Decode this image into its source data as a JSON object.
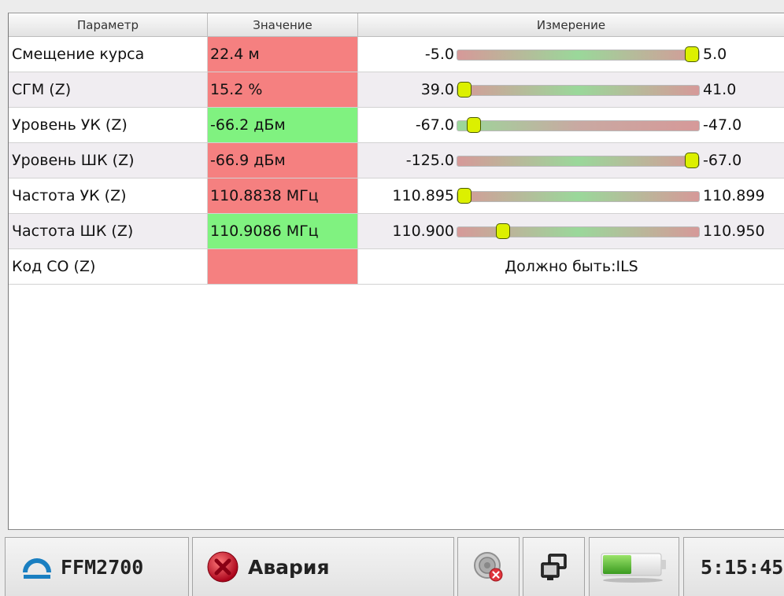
{
  "table": {
    "columns": [
      "Параметр",
      "Значение",
      "Измерение"
    ],
    "rows": [
      {
        "name": "Смещение курса",
        "value": "22.4 м",
        "value_status": "bad",
        "min": "-5.0",
        "max": "5.0",
        "bar_fraction": 1.0,
        "bar_good_zone": "center"
      },
      {
        "name": "СГМ (Z)",
        "value": "15.2 %",
        "value_status": "bad",
        "min": "39.0",
        "max": "41.0",
        "bar_fraction": 0.0,
        "bar_good_zone": "center"
      },
      {
        "name": "Уровень УК (Z)",
        "value": "-66.2 дБм",
        "value_status": "good",
        "min": "-67.0",
        "max": "-47.0",
        "bar_fraction": 0.04,
        "bar_good_zone": "left"
      },
      {
        "name": "Уровень ШК (Z)",
        "value": "-66.9 дБм",
        "value_status": "bad",
        "min": "-125.0",
        "max": "-67.0",
        "bar_fraction": 1.0,
        "bar_good_zone": "center"
      },
      {
        "name": "Частота УК (Z)",
        "value": "110.8838 МГц",
        "value_status": "bad",
        "min": "110.895",
        "max": "110.899",
        "bar_fraction": 0.0,
        "bar_good_zone": "center"
      },
      {
        "name": "Частота ШК (Z)",
        "value": "110.9086 МГц",
        "value_status": "good",
        "min": "110.900",
        "max": "110.950",
        "bar_fraction": 0.17,
        "bar_good_zone": "center"
      },
      {
        "name": "Код СО (Z)",
        "value": "",
        "value_status": "bad",
        "text": "Должно быть:ILS"
      }
    ]
  },
  "taskbar": {
    "device": "FFM2700",
    "status": "Авария",
    "time": "5:15:45",
    "battery_level": 0.5,
    "icons": [
      "speaker-muted-icon",
      "network-icon",
      "battery-icon"
    ]
  },
  "colors": {
    "bad": "#f58080",
    "good": "#80f280",
    "thumb": "#dcf000",
    "brand": "#1a7fc1",
    "alarm": "#c8102e"
  }
}
